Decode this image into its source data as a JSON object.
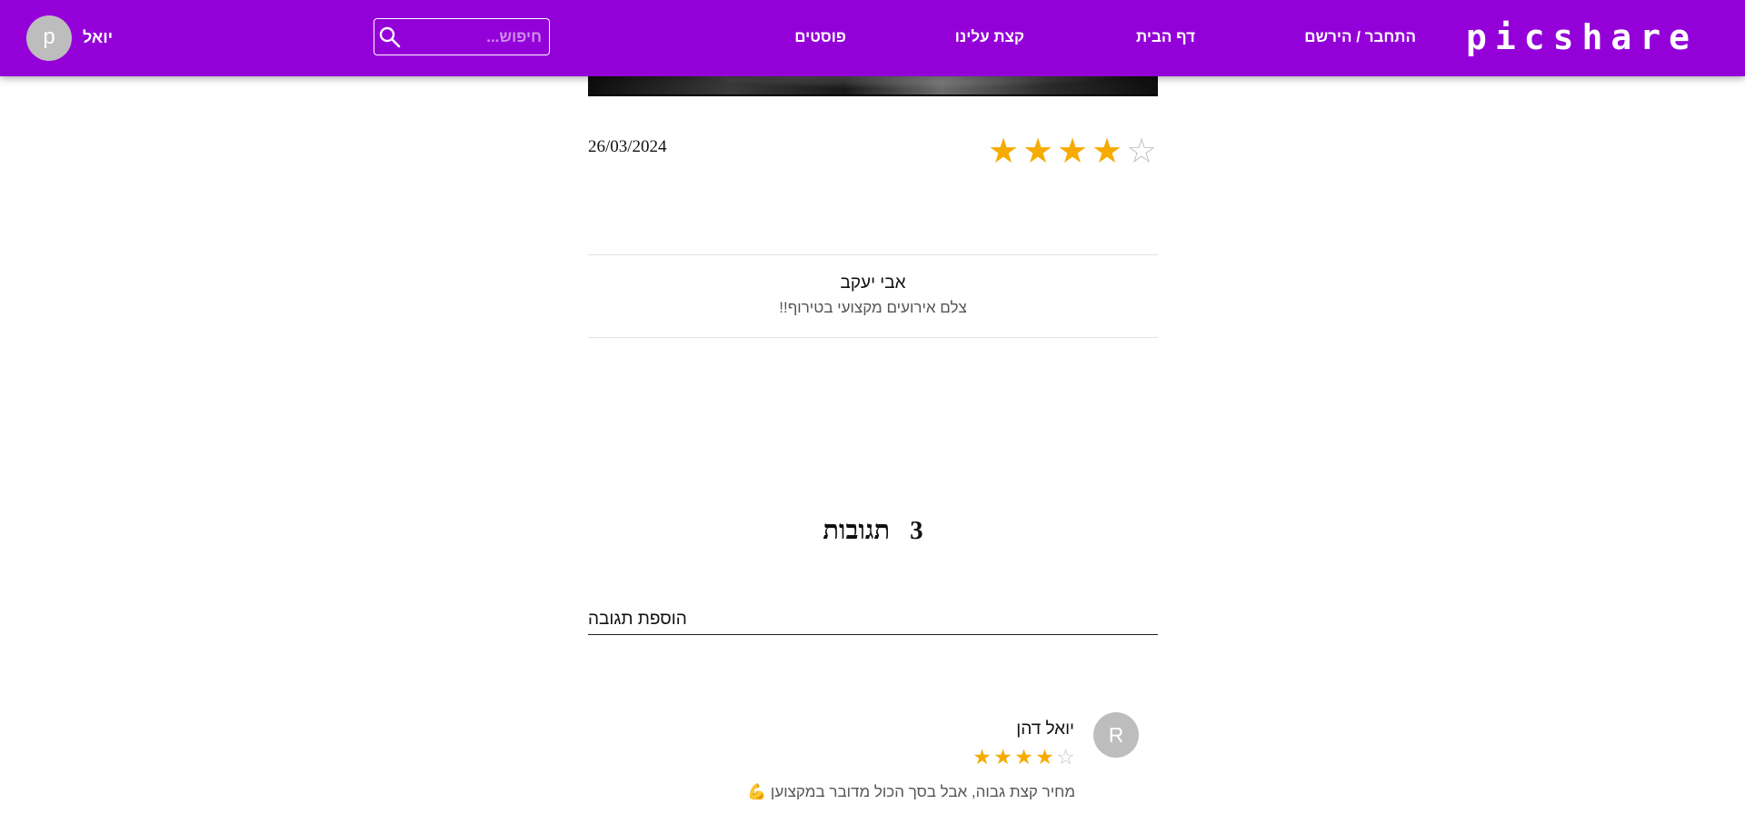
{
  "header": {
    "logo": "picshare",
    "nav": {
      "login": "התחבר / הירשם",
      "home": "דף הבית",
      "about": "קצת עלינו",
      "posts": "פוסטים"
    },
    "search_placeholder": "חיפוש...",
    "user_avatar_letter": "p",
    "username": "יואל",
    "brand_color": "#9400d8"
  },
  "post": {
    "date": "26/03/2024",
    "rating": 4,
    "rating_max": 5,
    "author_name": "אבי יעקב",
    "author_bio": "צלם אירועים מקצועי בטירוף!!"
  },
  "comments": {
    "count": "3",
    "title": "תגובות",
    "add_label": "הוספת תגובה",
    "items": [
      {
        "avatar_letter": "R",
        "author": "יואל דהן",
        "rating": 4,
        "rating_max": 5,
        "text": "מחיר קצת גבוה, אבל בסך הכול מדובר במקצוען 💪"
      }
    ]
  },
  "colors": {
    "star_filled": "#f5ab00",
    "star_empty": "#c4c4c4"
  }
}
